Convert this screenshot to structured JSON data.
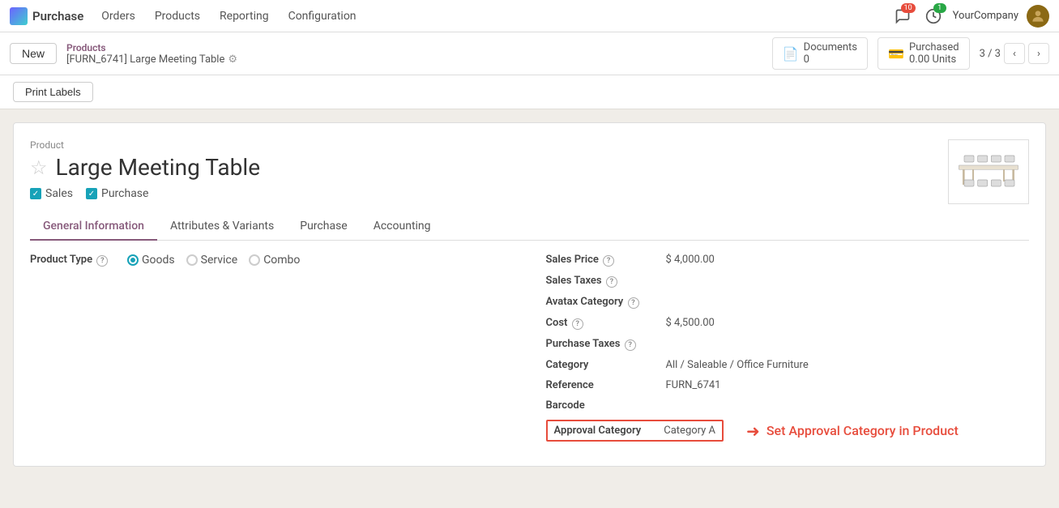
{
  "nav": {
    "logo_text": "Purchase",
    "items": [
      "Orders",
      "Products",
      "Reporting",
      "Configuration"
    ],
    "notifications_count": "10",
    "timer_count": "1",
    "company": "YourCompany"
  },
  "breadcrumb": {
    "new_label": "New",
    "parent_link": "Products",
    "current": "[FURN_6741] Large Meeting Table",
    "pagination": "3 / 3"
  },
  "stats": {
    "documents_label": "Documents",
    "documents_count": "0",
    "purchased_label": "Purchased",
    "purchased_value": "0.00 Units"
  },
  "action": {
    "print_labels": "Print Labels"
  },
  "product": {
    "section_label": "Product",
    "title": "Large Meeting Table",
    "checks": [
      "Sales",
      "Purchase"
    ]
  },
  "tabs": [
    "General Information",
    "Attributes & Variants",
    "Purchase",
    "Accounting"
  ],
  "active_tab": "General Information",
  "product_type": {
    "label": "Product Type",
    "options": [
      "Goods",
      "Service",
      "Combo"
    ],
    "selected": "Goods"
  },
  "fields": {
    "sales_price_label": "Sales Price",
    "sales_price_value": "$ 4,000.00",
    "sales_taxes_label": "Sales Taxes",
    "sales_taxes_value": "",
    "avatax_label": "Avatax Category",
    "avatax_value": "",
    "cost_label": "Cost",
    "cost_value": "$ 4,500.00",
    "purchase_taxes_label": "Purchase Taxes",
    "purchase_taxes_value": "",
    "category_label": "Category",
    "category_value": "All / Saleable / Office Furniture",
    "reference_label": "Reference",
    "reference_value": "FURN_6741",
    "barcode_label": "Barcode",
    "barcode_value": "",
    "approval_category_label": "Approval Category",
    "approval_category_value": "Category A"
  },
  "annotation": {
    "text": "Set Approval Category in Product"
  }
}
